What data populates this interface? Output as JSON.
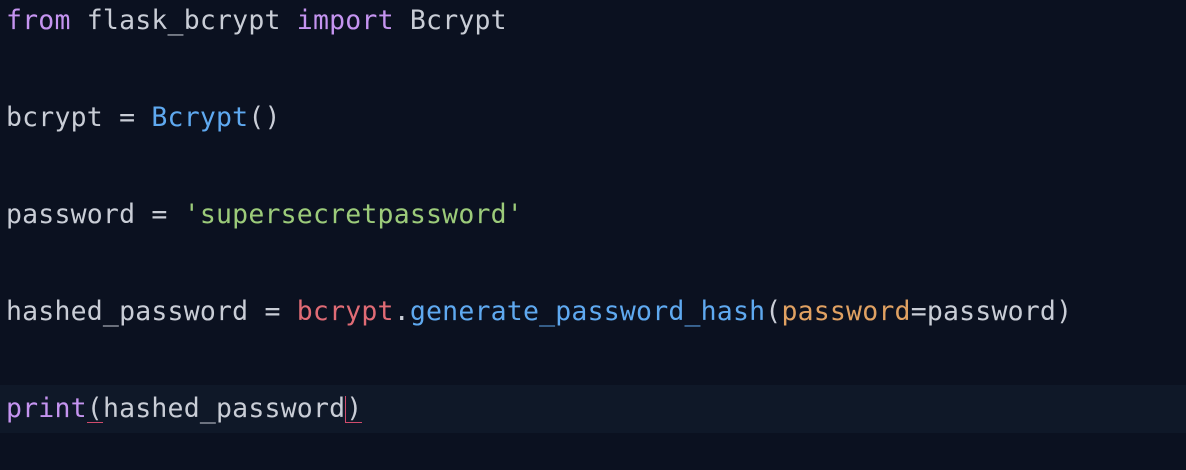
{
  "code": {
    "line1": {
      "kw_from": "from",
      "module": " flask_bcrypt ",
      "kw_import": "import",
      "name": " Bcrypt"
    },
    "line2": {
      "target": "bcrypt = ",
      "call": "Bcrypt",
      "parens": "()"
    },
    "line3": {
      "target": "password = ",
      "string": "'supersecretpassword'"
    },
    "line4": {
      "target": "hashed_password = ",
      "object": "bcrypt",
      "dot": ".",
      "method": "generate_password_hash",
      "open": "(",
      "kwarg": "password",
      "eq": "=",
      "value": "password",
      "close": ")"
    },
    "line5": {
      "fn": "print",
      "open": "(",
      "arg": "hashed_password",
      "close": ")"
    }
  },
  "colors": {
    "background": "#0b1120",
    "keyword": "#c594f0",
    "function": "#5fa9f0",
    "string": "#9ccb7a",
    "variable": "#e06b75",
    "parameter": "#e0a162",
    "bracket_highlight": "#d04b6c"
  }
}
